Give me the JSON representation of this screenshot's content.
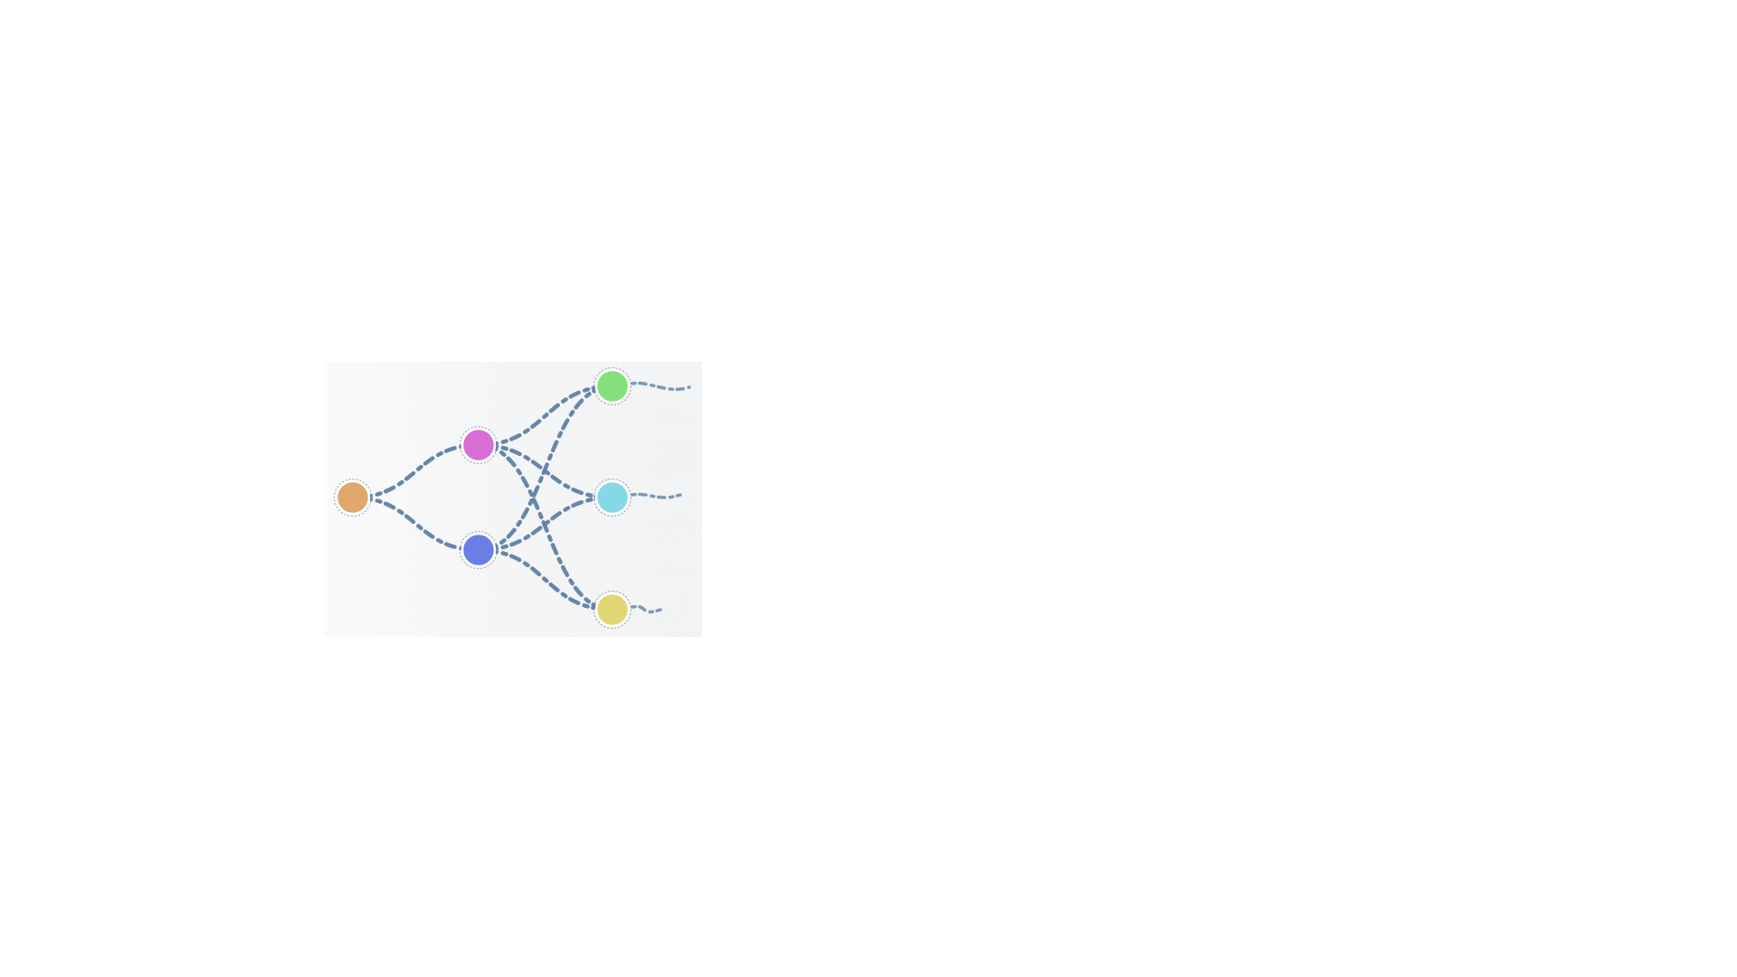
{
  "diagram": {
    "type": "network-graph",
    "background_color": "#eeeff0",
    "edge_color": "#5f7fa5",
    "nodes": [
      {
        "id": "n1",
        "color": "#e0a86a"
      },
      {
        "id": "n2",
        "color": "#d86ed4"
      },
      {
        "id": "n3",
        "color": "#6a7fe4"
      },
      {
        "id": "n4",
        "color": "#84e07a"
      },
      {
        "id": "n5",
        "color": "#86d8e8"
      },
      {
        "id": "n6",
        "color": "#e2d674"
      }
    ],
    "edges": [
      {
        "from": "n1",
        "to": "n2"
      },
      {
        "from": "n1",
        "to": "n3"
      },
      {
        "from": "n2",
        "to": "n4"
      },
      {
        "from": "n2",
        "to": "n5"
      },
      {
        "from": "n2",
        "to": "n6"
      },
      {
        "from": "n3",
        "to": "n4"
      },
      {
        "from": "n3",
        "to": "n5"
      },
      {
        "from": "n3",
        "to": "n6"
      }
    ],
    "outgoing_tails": [
      "n4",
      "n5",
      "n6"
    ]
  }
}
